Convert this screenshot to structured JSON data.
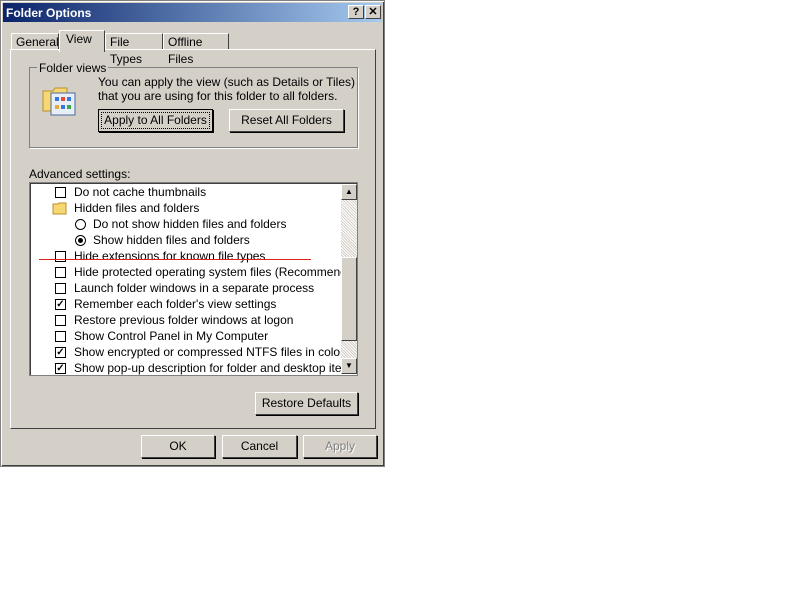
{
  "window": {
    "title": "Folder Options",
    "help_btn": "?",
    "close_btn": "✕"
  },
  "tabs": [
    {
      "label": "General"
    },
    {
      "label": "View"
    },
    {
      "label": "File Types"
    },
    {
      "label": "Offline Files"
    }
  ],
  "folder_views": {
    "group_label": "Folder views",
    "description": "You can apply the view (such as Details or Tiles) that you are using for this folder to all folders.",
    "apply_btn": "Apply to All Folders",
    "reset_btn": "Reset All Folders"
  },
  "advanced": {
    "label": "Advanced settings:",
    "items": [
      {
        "type": "checkbox",
        "checked": false,
        "label": "Do not cache thumbnails"
      },
      {
        "type": "folder",
        "label": "Hidden files and folders"
      },
      {
        "type": "radio",
        "checked": false,
        "label": "Do not show hidden files and folders"
      },
      {
        "type": "radio",
        "checked": true,
        "label": "Show hidden files and folders"
      },
      {
        "type": "checkbox",
        "checked": false,
        "label": "Hide extensions for known file types"
      },
      {
        "type": "checkbox",
        "checked": false,
        "label": "Hide protected operating system files (Recommended)"
      },
      {
        "type": "checkbox",
        "checked": false,
        "label": "Launch folder windows in a separate process"
      },
      {
        "type": "checkbox",
        "checked": true,
        "label": "Remember each folder's view settings"
      },
      {
        "type": "checkbox",
        "checked": false,
        "label": "Restore previous folder windows at logon"
      },
      {
        "type": "checkbox",
        "checked": false,
        "label": "Show Control Panel in My Computer"
      },
      {
        "type": "checkbox",
        "checked": true,
        "label": "Show encrypted or compressed NTFS files in color"
      },
      {
        "type": "checkbox",
        "checked": true,
        "label": "Show pop-up description for folder and desktop items"
      }
    ],
    "restore_btn": "Restore Defaults"
  },
  "footer": {
    "ok": "OK",
    "cancel": "Cancel",
    "apply": "Apply"
  },
  "colors": {
    "annotation_line": "#e0201c",
    "titlebar_start": "#0a246a",
    "face": "#d4d0c8"
  }
}
